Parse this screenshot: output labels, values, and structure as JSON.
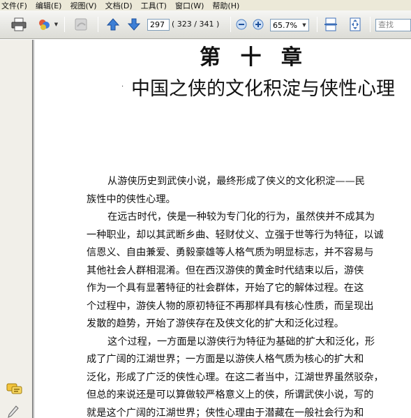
{
  "menu": [
    "文件(F)",
    "编辑(E)",
    "视图(V)",
    "文档(D)",
    "工具(T)",
    "窗口(W)",
    "帮助(H)"
  ],
  "toolbar": {
    "page_number": "297",
    "page_count": "( 323 / 341 )",
    "zoom": "65.7%",
    "find_placeholder": "查找"
  },
  "document": {
    "chapter_title": "第 十 章",
    "section_title": "中国之侠的文化积淀与侠性心理",
    "lines": [
      "从游侠历史到武侠小说，最终形成了侠义的文化积淀——民",
      "族性中的侠性心理。",
      "在远古时代，侠是一种较为专门化的行为，虽然侠并不成其为",
      "一种职业，却以其武断乡曲、轻财仗义、立强于世等行为特征，以诚",
      "信恩义、自由兼爱、勇毅豪雄等人格气质为明显标志，并不容易与",
      "其他社会人群相混淆。但在西汉游侠的黄金时代结束以后，游侠",
      "作为一个具有显著特征的社会群体，开始了它的解体过程。在这",
      "个过程中，游侠人物的原初特征不再那样具有核心性质，而呈现出",
      "发散的趋势，开始了游侠存在及侠文化的扩大和泛化过程。",
      "这个过程，一方面是以游侠行为特征为基础的扩大和泛化，形",
      "成了广阔的江湖世界；一方面是以游侠人格气质为核心的扩大和",
      "泛化，形成了广泛的侠性心理。在这二者当中，江湖世界虽然驳杂，",
      "但总的来说还是可以算做较严格意义上的侠，所谓武侠小说，写的",
      "就是这个广阔的江湖世界；侠性心理由于潜藏在一般社会行为和"
    ]
  }
}
